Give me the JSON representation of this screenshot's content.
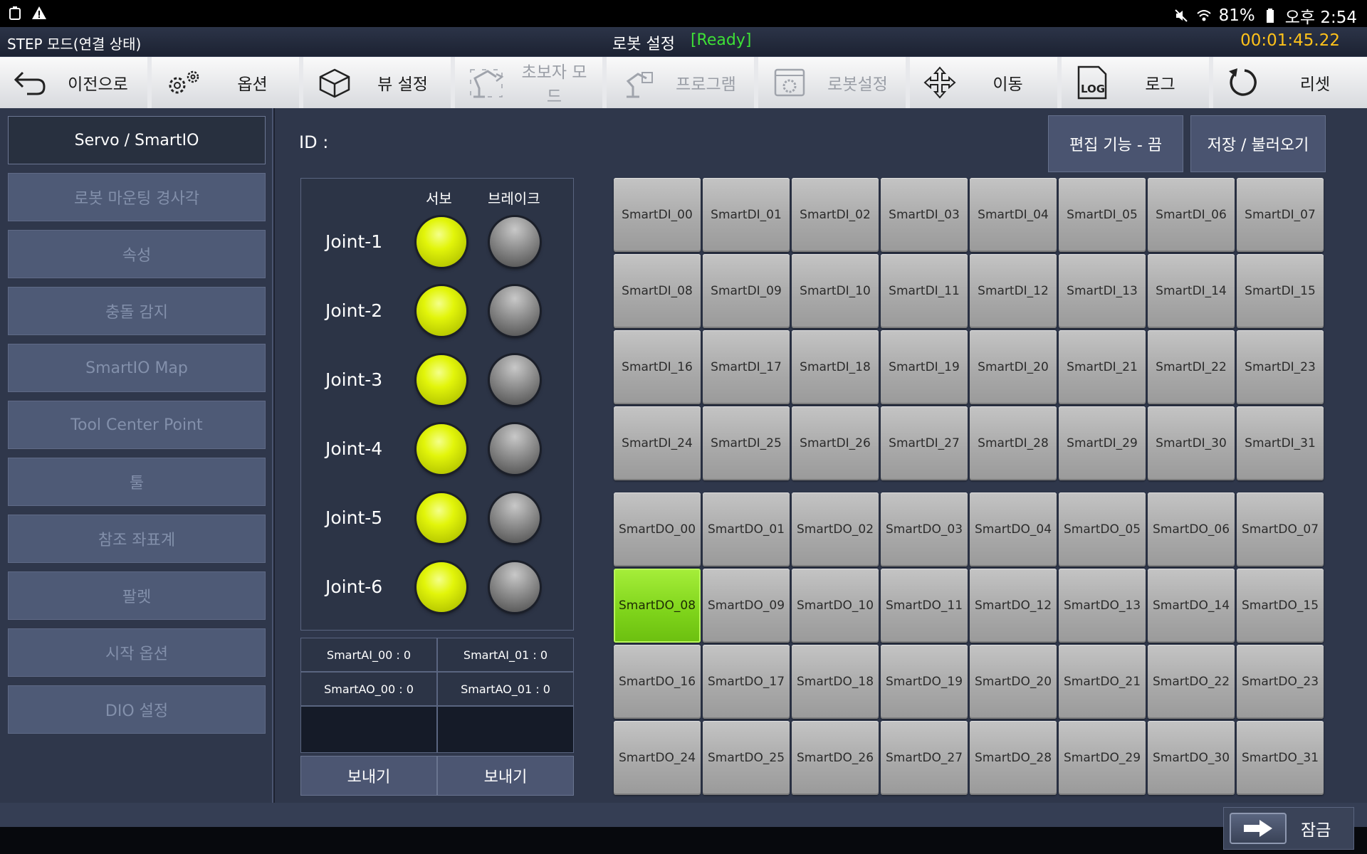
{
  "statusbar": {
    "battery": "81%",
    "time": "오후 2:54"
  },
  "titlebar": {
    "mode": "STEP 모드(연결 상태)",
    "title": "로봇 설정",
    "status": "[Ready]",
    "timer": "00:01:45.22"
  },
  "toolbar": [
    {
      "label": "이전으로",
      "icon": "back-arrow-icon",
      "enabled": true
    },
    {
      "label": "옵션",
      "icon": "gears-icon",
      "enabled": true
    },
    {
      "label": "뷰 설정",
      "icon": "cube-icon",
      "enabled": true
    },
    {
      "label": "초보자 모드",
      "icon": "robot-arm-icon",
      "enabled": false
    },
    {
      "label": "프로그램",
      "icon": "program-icon",
      "enabled": false
    },
    {
      "label": "로봇설정",
      "icon": "robot-settings-icon",
      "enabled": false
    },
    {
      "label": "이동",
      "icon": "move-arrows-icon",
      "enabled": true
    },
    {
      "label": "로그",
      "icon": "log-icon",
      "enabled": true
    },
    {
      "label": "리셋",
      "icon": "reset-icon",
      "enabled": true
    }
  ],
  "sidebar": {
    "items": [
      "Servo / SmartIO",
      "로봇 마운팅 경사각",
      "속성",
      "충돌 감지",
      "SmartIO Map",
      "Tool Center Point",
      "툴",
      "참조 좌표계",
      "팔렛",
      "시작 옵션",
      "DIO 설정"
    ],
    "active": 0
  },
  "main": {
    "id_label": "ID :",
    "edit_button": "편집 기능 - 끔",
    "save_button": "저장 / 불러오기",
    "servo_header": "서보",
    "brake_header": "브레이크",
    "joints": [
      {
        "name": "Joint-1",
        "servo": true,
        "brake": false
      },
      {
        "name": "Joint-2",
        "servo": true,
        "brake": false
      },
      {
        "name": "Joint-3",
        "servo": true,
        "brake": false
      },
      {
        "name": "Joint-4",
        "servo": true,
        "brake": false
      },
      {
        "name": "Joint-5",
        "servo": true,
        "brake": false
      },
      {
        "name": "Joint-6",
        "servo": true,
        "brake": false
      }
    ],
    "analog": [
      "SmartAI_00 : 0",
      "SmartAI_01 : 0",
      "SmartAO_00 : 0",
      "SmartAO_01 : 0"
    ],
    "send_buttons": [
      "보내기",
      "보내기"
    ],
    "digital_inputs": [
      "SmartDI_00",
      "SmartDI_01",
      "SmartDI_02",
      "SmartDI_03",
      "SmartDI_04",
      "SmartDI_05",
      "SmartDI_06",
      "SmartDI_07",
      "SmartDI_08",
      "SmartDI_09",
      "SmartDI_10",
      "SmartDI_11",
      "SmartDI_12",
      "SmartDI_13",
      "SmartDI_14",
      "SmartDI_15",
      "SmartDI_16",
      "SmartDI_17",
      "SmartDI_18",
      "SmartDI_19",
      "SmartDI_20",
      "SmartDI_21",
      "SmartDI_22",
      "SmartDI_23",
      "SmartDI_24",
      "SmartDI_25",
      "SmartDI_26",
      "SmartDI_27",
      "SmartDI_28",
      "SmartDI_29",
      "SmartDI_30",
      "SmartDI_31"
    ],
    "digital_outputs": [
      "SmartDO_00",
      "SmartDO_01",
      "SmartDO_02",
      "SmartDO_03",
      "SmartDO_04",
      "SmartDO_05",
      "SmartDO_06",
      "SmartDO_07",
      "SmartDO_08",
      "SmartDO_09",
      "SmartDO_10",
      "SmartDO_11",
      "SmartDO_12",
      "SmartDO_13",
      "SmartDO_14",
      "SmartDO_15",
      "SmartDO_16",
      "SmartDO_17",
      "SmartDO_18",
      "SmartDO_19",
      "SmartDO_20",
      "SmartDO_21",
      "SmartDO_22",
      "SmartDO_23",
      "SmartDO_24",
      "SmartDO_25",
      "SmartDO_26",
      "SmartDO_27",
      "SmartDO_28",
      "SmartDO_29",
      "SmartDO_30",
      "SmartDO_31"
    ],
    "active_outputs": [
      "SmartDO_08"
    ]
  },
  "lock_button": "잠금",
  "colors": {
    "ready": "#3ee036",
    "timer": "#ffc21a",
    "led_on": "#e2f50a",
    "output_on": "#7ed31a"
  }
}
